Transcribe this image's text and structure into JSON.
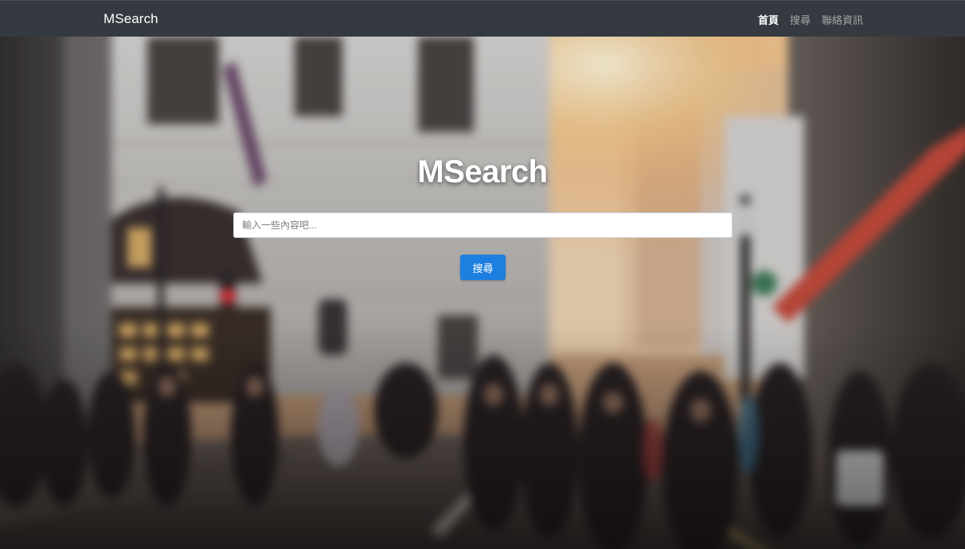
{
  "navbar": {
    "brand": "MSearch",
    "links": [
      {
        "label": "首頁",
        "active": true
      },
      {
        "label": "搜尋",
        "active": false
      },
      {
        "label": "聯絡資訊",
        "active": false
      }
    ]
  },
  "hero": {
    "title": "MSearch",
    "search": {
      "placeholder": "輸入一些內容吧...",
      "value": "",
      "button_label": "搜尋"
    }
  },
  "colors": {
    "navbar_bg": "#343a40",
    "button_primary": "#1d7fe0"
  }
}
